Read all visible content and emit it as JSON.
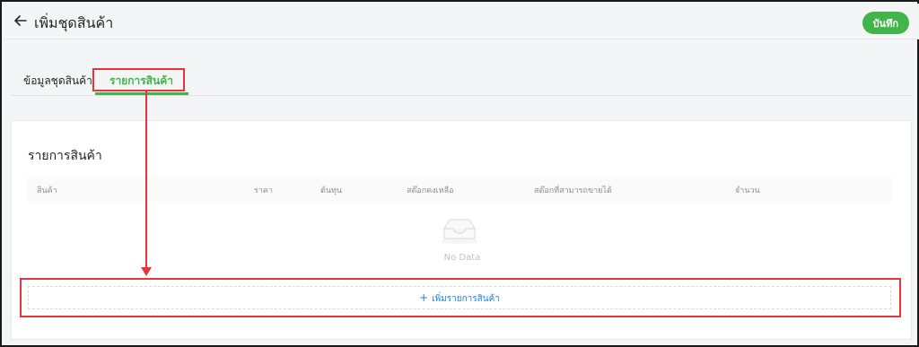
{
  "header": {
    "title": "เพิ่มชุดสินค้า",
    "save_label": "บันทึก"
  },
  "tabs": [
    {
      "label": "ข้อมูลชุดสินค้า",
      "active": false
    },
    {
      "label": "รายการสินค้า",
      "active": true
    }
  ],
  "section": {
    "title": "รายการสินค้า"
  },
  "table": {
    "columns": [
      "สินค้า",
      "ราคา",
      "ต้นทุน",
      "สต๊อกคงเหลือ",
      "สต๊อกที่สามารถขายได้",
      "จำนวน"
    ],
    "rows": [],
    "empty_text": "No Data"
  },
  "add_item": {
    "plus": "+",
    "label": "เพิ่มรายการสินค้า"
  },
  "colors": {
    "accent": "#40b549",
    "link": "#1f7fd6",
    "annotation": "#e8343a"
  }
}
